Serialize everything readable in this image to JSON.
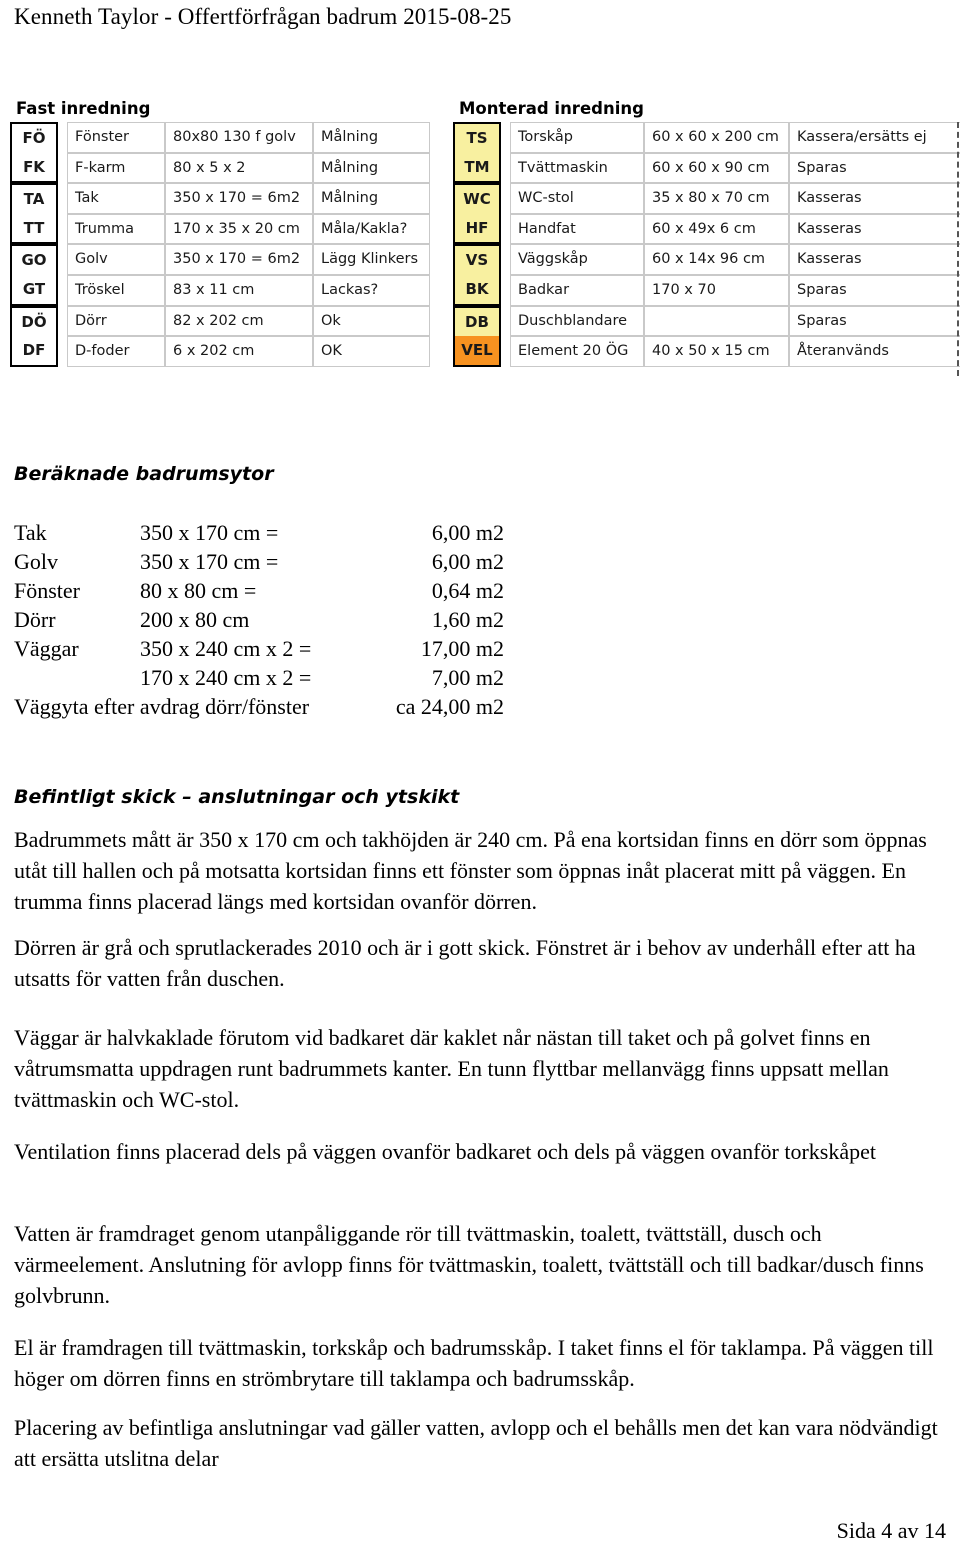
{
  "header": {
    "title": "Kenneth Taylor  - Offertförfrågan badrum 2015-08-25"
  },
  "sheets": {
    "left": {
      "title": "Fast inredning",
      "rows": [
        {
          "code": "FÖ",
          "name": "Fönster",
          "dim": "80x80 130 f golv",
          "note": "Målning"
        },
        {
          "code": "FK",
          "name": "F-karm",
          "dim": "80 x 5 x 2",
          "note": "Målning"
        },
        {
          "code": "TA",
          "name": "Tak",
          "dim": "350 x 170 = 6m2",
          "note": "Målning"
        },
        {
          "code": "TT",
          "name": "Trumma",
          "dim": "170 x 35 x 20 cm",
          "note": "Måla/Kakla?"
        },
        {
          "code": "GO",
          "name": "Golv",
          "dim": "350 x 170 = 6m2",
          "note": "Lägg Klinkers"
        },
        {
          "code": "GT",
          "name": "Tröskel",
          "dim": "83 x 11 cm",
          "note": "Lackas?"
        },
        {
          "code": "DÖ",
          "name": "Dörr",
          "dim": "82 x 202 cm",
          "note": "Ok"
        },
        {
          "code": "DF",
          "name": "D-foder",
          "dim": "6 x 202 cm",
          "note": "OK"
        }
      ]
    },
    "right": {
      "title": "Monterad inredning",
      "rows": [
        {
          "code": "TS",
          "name": "Torskåp",
          "dim": "60 x 60 x 200 cm",
          "note": "Kassera/ersätts ej"
        },
        {
          "code": "TM",
          "name": "Tvättmaskin",
          "dim": "60 x 60 x 90 cm",
          "note": "Sparas"
        },
        {
          "code": "WC",
          "name": "WC-stol",
          "dim": "35 x 80 x 70 cm",
          "note": "Kasseras"
        },
        {
          "code": "HF",
          "name": "Handfat",
          "dim": "60 x 49x 6 cm",
          "note": "Kasseras"
        },
        {
          "code": "VS",
          "name": "Väggskåp",
          "dim": "60 x 14x 96 cm",
          "note": "Kasseras"
        },
        {
          "code": "BK",
          "name": "Badkar",
          "dim": "170 x 70",
          "note": "Sparas"
        },
        {
          "code": "DB",
          "name": "Duschblandare",
          "dim": "",
          "note": "Sparas"
        },
        {
          "code": "VEL",
          "name": "Element 20 ÖG",
          "dim": "40 x 50 x 15 cm",
          "note": "Återanvänds"
        }
      ]
    }
  },
  "colors": {
    "code_fill": "#f8f0a0",
    "code_fill_highlight": "#f79220",
    "grid_line": "#c9c9c9",
    "text": "#000000"
  },
  "areas": {
    "heading": "Beräknade badrumsytor",
    "rows": [
      {
        "label": "Tak",
        "expr": "350 x 170 cm =",
        "value": "6,00 m2"
      },
      {
        "label": "Golv",
        "expr": "350 x 170 cm =",
        "value": "6,00 m2"
      },
      {
        "label": "Fönster",
        "expr": "80 x 80 cm  =",
        "value": "0,64 m2"
      },
      {
        "label": "Dörr",
        "expr": "200 x 80 cm",
        "value": "1,60 m2"
      },
      {
        "label": "Väggar",
        "expr": "350 x 240 cm x 2 =",
        "value": "17,00 m2"
      },
      {
        "label": "",
        "expr": "170 x 240 cm x 2 =",
        "value": "7,00 m2"
      }
    ],
    "summary": {
      "label": "Väggyta efter avdrag dörr/fönster",
      "value": "ca 24,00 m2"
    }
  },
  "condition": {
    "heading": "Befintligt skick – anslutningar och ytskikt",
    "paragraphs": [
      "Badrummets mått är 350 x 170 cm och takhöjden är 240 cm. På ena kortsidan finns en dörr som öppnas utåt till hallen och på motsatta kortsidan finns ett fönster som öppnas inåt placerat mitt på väggen. En trumma finns placerad längs med kortsidan ovanför dörren.",
      "Dörren är grå och sprutlackerades 2010 och är i gott skick. Fönstret är i behov av underhåll efter att ha utsatts för vatten från duschen.",
      "Väggar är halvkaklade förutom vid badkaret där kaklet når nästan till taket och på golvet finns en våtrumsmatta uppdragen runt badrummets kanter. En tunn flyttbar mellanvägg finns uppsatt mellan tvättmaskin och WC-stol.",
      "Ventilation finns placerad dels på väggen ovanför badkaret och dels på väggen ovanför torkskåpet",
      "Vatten är framdraget genom utanpåliggande rör till tvättmaskin, toalett, tvättställ, dusch och värmeelement. Anslutning för avlopp finns för tvättmaskin, toalett, tvättställ och till badkar/dusch finns golvbrunn.",
      "El är framdragen till tvättmaskin, torkskåp och badrumsskåp. I taket finns el för taklampa. På väggen till höger om dörren finns en strömbrytare till taklampa och badrumsskåp.",
      "Placering av befintliga anslutningar vad gäller vatten, avlopp och el behålls men det kan vara nödvändigt att ersätta utslitna delar"
    ]
  },
  "footer": {
    "page_label": "Sida 4 av 14"
  }
}
